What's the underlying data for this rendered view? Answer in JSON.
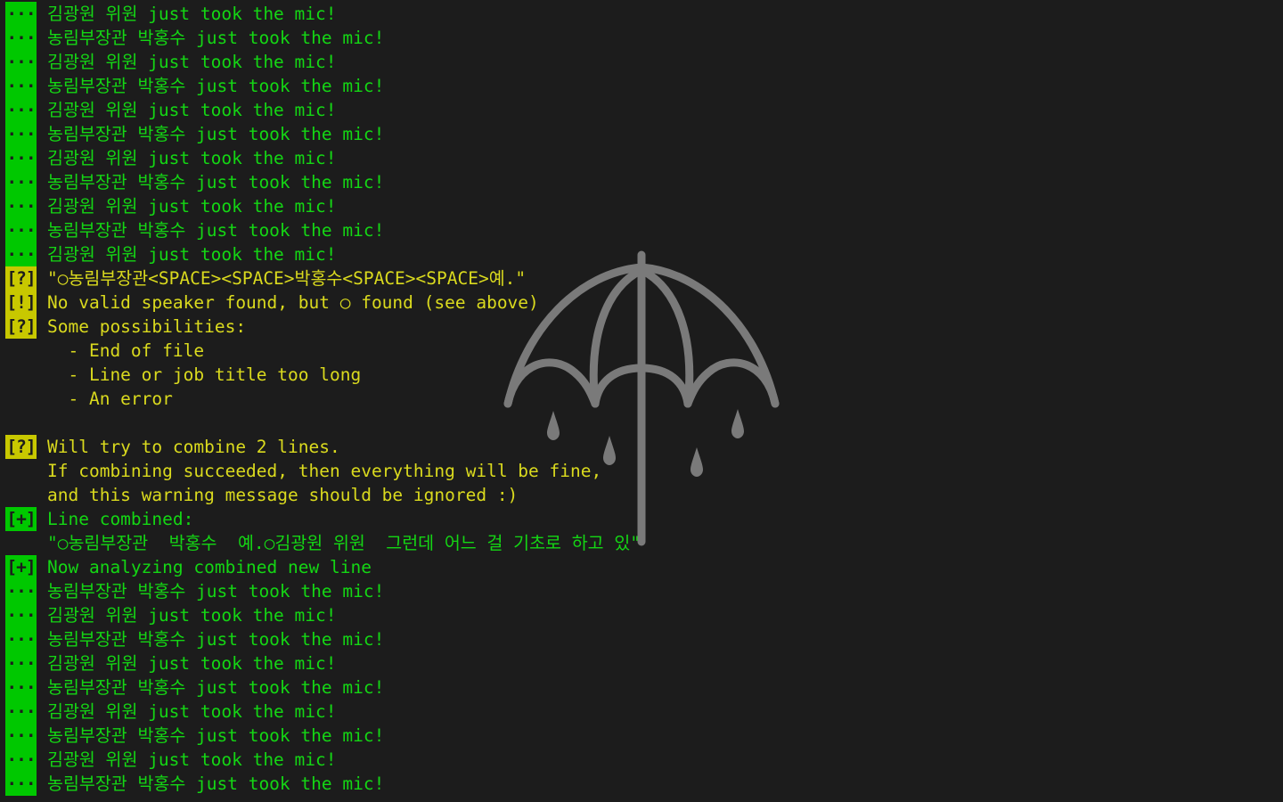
{
  "colors": {
    "background": "#1c1c1c",
    "green": "#14d614",
    "yellow": "#dada1e",
    "tag_green": "#00c800",
    "tag_yellow": "#c8c800",
    "umbrella": "#7a7a7a"
  },
  "background_image": {
    "icon": "umbrella-with-raindrops-icon"
  },
  "lines": [
    {
      "tag": "···",
      "tag_style": "ok",
      "text": "김광원 위원 just took the mic!",
      "color": "green"
    },
    {
      "tag": "···",
      "tag_style": "ok",
      "text": "농림부장관 박홍수 just took the mic!",
      "color": "green"
    },
    {
      "tag": "···",
      "tag_style": "ok",
      "text": "김광원 위원 just took the mic!",
      "color": "green"
    },
    {
      "tag": "···",
      "tag_style": "ok",
      "text": "농림부장관 박홍수 just took the mic!",
      "color": "green"
    },
    {
      "tag": "···",
      "tag_style": "ok",
      "text": "김광원 위원 just took the mic!",
      "color": "green"
    },
    {
      "tag": "···",
      "tag_style": "ok",
      "text": "농림부장관 박홍수 just took the mic!",
      "color": "green"
    },
    {
      "tag": "···",
      "tag_style": "ok",
      "text": "김광원 위원 just took the mic!",
      "color": "green"
    },
    {
      "tag": "···",
      "tag_style": "ok",
      "text": "농림부장관 박홍수 just took the mic!",
      "color": "green"
    },
    {
      "tag": "···",
      "tag_style": "ok",
      "text": "김광원 위원 just took the mic!",
      "color": "green"
    },
    {
      "tag": "···",
      "tag_style": "ok",
      "text": "농림부장관 박홍수 just took the mic!",
      "color": "green"
    },
    {
      "tag": "···",
      "tag_style": "ok",
      "text": "김광원 위원 just took the mic!",
      "color": "green"
    },
    {
      "tag": "[?]",
      "tag_style": "warn",
      "text": "\"○농림부장관<SPACE><SPACE>박홍수<SPACE><SPACE>예.\"",
      "color": "yellow"
    },
    {
      "tag": "[!]",
      "tag_style": "warn",
      "text": "No valid speaker found, but ○ found (see above)",
      "color": "yellow"
    },
    {
      "tag": "[?]",
      "tag_style": "warn",
      "text": "Some possibilities:",
      "color": "yellow"
    },
    {
      "tag": "",
      "tag_style": "none",
      "text": "  - End of file",
      "color": "yellow"
    },
    {
      "tag": "",
      "tag_style": "none",
      "text": "  - Line or job title too long",
      "color": "yellow"
    },
    {
      "tag": "",
      "tag_style": "none",
      "text": "  - An error",
      "color": "yellow"
    },
    {
      "tag": "",
      "tag_style": "none",
      "text": "",
      "color": "yellow"
    },
    {
      "tag": "[?]",
      "tag_style": "warn",
      "text": "Will try to combine 2 lines.",
      "color": "yellow"
    },
    {
      "tag": "",
      "tag_style": "none",
      "text": "If combining succeeded, then everything will be fine,",
      "color": "yellow"
    },
    {
      "tag": "",
      "tag_style": "none",
      "text": "and this warning message should be ignored :)",
      "color": "yellow"
    },
    {
      "tag": "[+]",
      "tag_style": "ok",
      "text": "Line combined:",
      "color": "green"
    },
    {
      "tag": "",
      "tag_style": "none",
      "text": "\"○농림부장관  박홍수  예.○김광원 위원  그런데 어느 걸 기초로 하고 있\"",
      "color": "green"
    },
    {
      "tag": "[+]",
      "tag_style": "ok",
      "text": "Now analyzing combined new line",
      "color": "green"
    },
    {
      "tag": "···",
      "tag_style": "ok",
      "text": "농림부장관 박홍수 just took the mic!",
      "color": "green"
    },
    {
      "tag": "···",
      "tag_style": "ok",
      "text": "김광원 위원 just took the mic!",
      "color": "green"
    },
    {
      "tag": "···",
      "tag_style": "ok",
      "text": "농림부장관 박홍수 just took the mic!",
      "color": "green"
    },
    {
      "tag": "···",
      "tag_style": "ok",
      "text": "김광원 위원 just took the mic!",
      "color": "green"
    },
    {
      "tag": "···",
      "tag_style": "ok",
      "text": "농림부장관 박홍수 just took the mic!",
      "color": "green"
    },
    {
      "tag": "···",
      "tag_style": "ok",
      "text": "김광원 위원 just took the mic!",
      "color": "green"
    },
    {
      "tag": "···",
      "tag_style": "ok",
      "text": "농림부장관 박홍수 just took the mic!",
      "color": "green"
    },
    {
      "tag": "···",
      "tag_style": "ok",
      "text": "김광원 위원 just took the mic!",
      "color": "green"
    },
    {
      "tag": "···",
      "tag_style": "ok",
      "text": "농림부장관 박홍수 just took the mic!",
      "color": "green"
    }
  ]
}
